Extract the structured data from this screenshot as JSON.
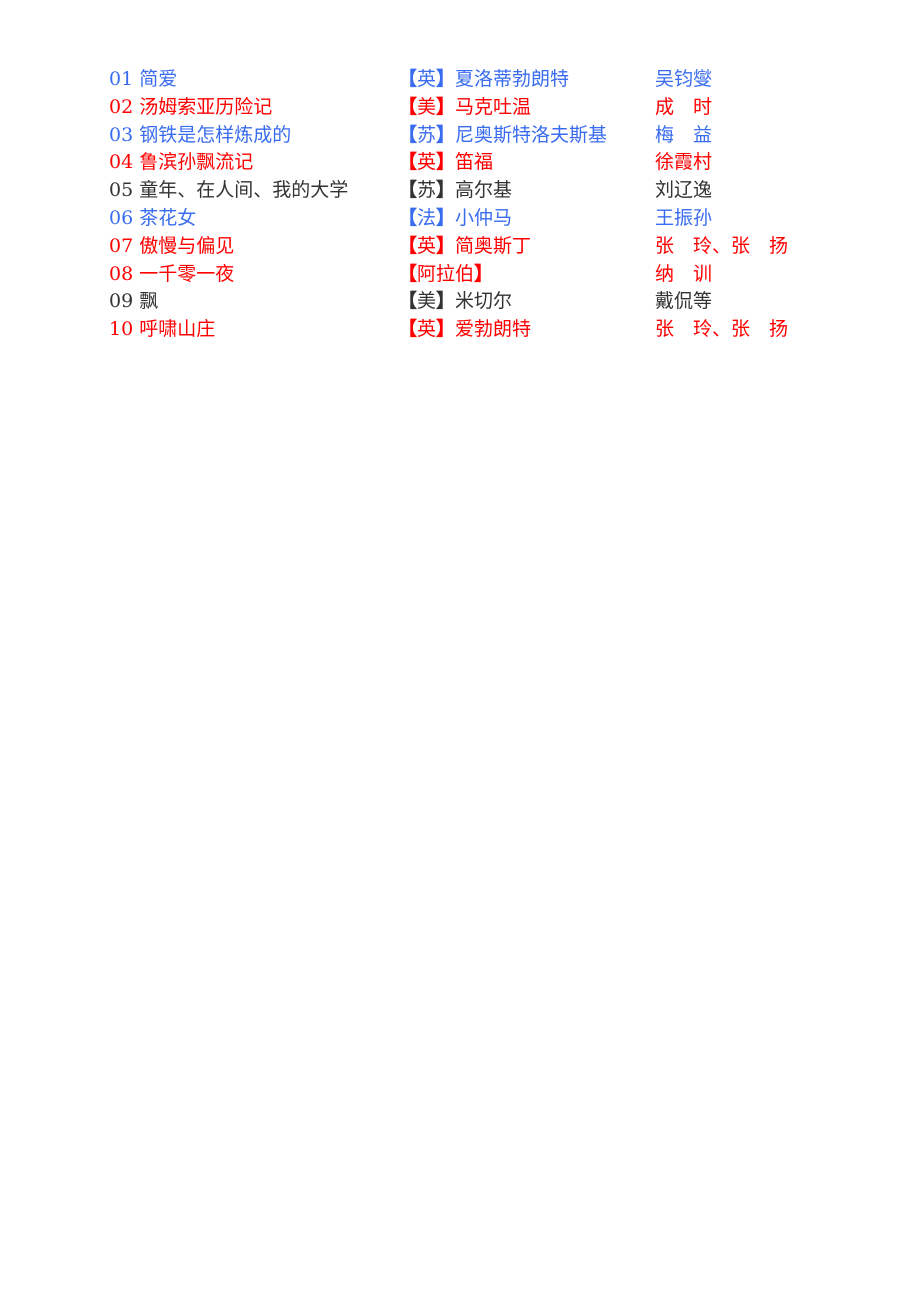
{
  "colors": {
    "blue": "#3a6cf0",
    "red": "#ff0000",
    "dark": "#333333"
  },
  "books": [
    {
      "number": "01",
      "title": "简爱",
      "country": "英",
      "author": "夏洛蒂勃朗特",
      "translator": "吴钧燮",
      "color": "blue"
    },
    {
      "number": "02",
      "title": "汤姆索亚历险记",
      "country": "美",
      "author": "马克吐温",
      "translator": "成　时",
      "color": "red"
    },
    {
      "number": "03",
      "title": "钢铁是怎样炼成的",
      "country": "苏",
      "author": "尼奥斯特洛夫斯基",
      "translator": "梅　益",
      "color": "blue"
    },
    {
      "number": "04",
      "title": "鲁滨孙飘流记",
      "country": "英",
      "author": "笛福",
      "translator": "徐霞村",
      "color": "red"
    },
    {
      "number": "05",
      "title": "童年、在人间、我的大学",
      "country": "苏",
      "author": "高尔基",
      "translator": "刘辽逸",
      "color": "dark"
    },
    {
      "number": "06",
      "title": "茶花女",
      "country": "法",
      "author": "小仲马",
      "translator": "王振孙",
      "color": "blue"
    },
    {
      "number": "07",
      "title": "傲慢与偏见",
      "country": "英",
      "author": "简奥斯丁",
      "translator": "张　玲、张　扬",
      "color": "red"
    },
    {
      "number": "08",
      "title": "一千零一夜",
      "country": "阿拉伯",
      "author": "",
      "translator": "纳　训",
      "color": "red"
    },
    {
      "number": "09",
      "title": "飘",
      "country": "美",
      "author": "米切尔",
      "translator": "戴侃等",
      "color": "dark"
    },
    {
      "number": "10",
      "title": "呼啸山庄",
      "country": "英",
      "author": "爱勃朗特",
      "translator": "张　玲、张　扬",
      "color": "red"
    }
  ]
}
